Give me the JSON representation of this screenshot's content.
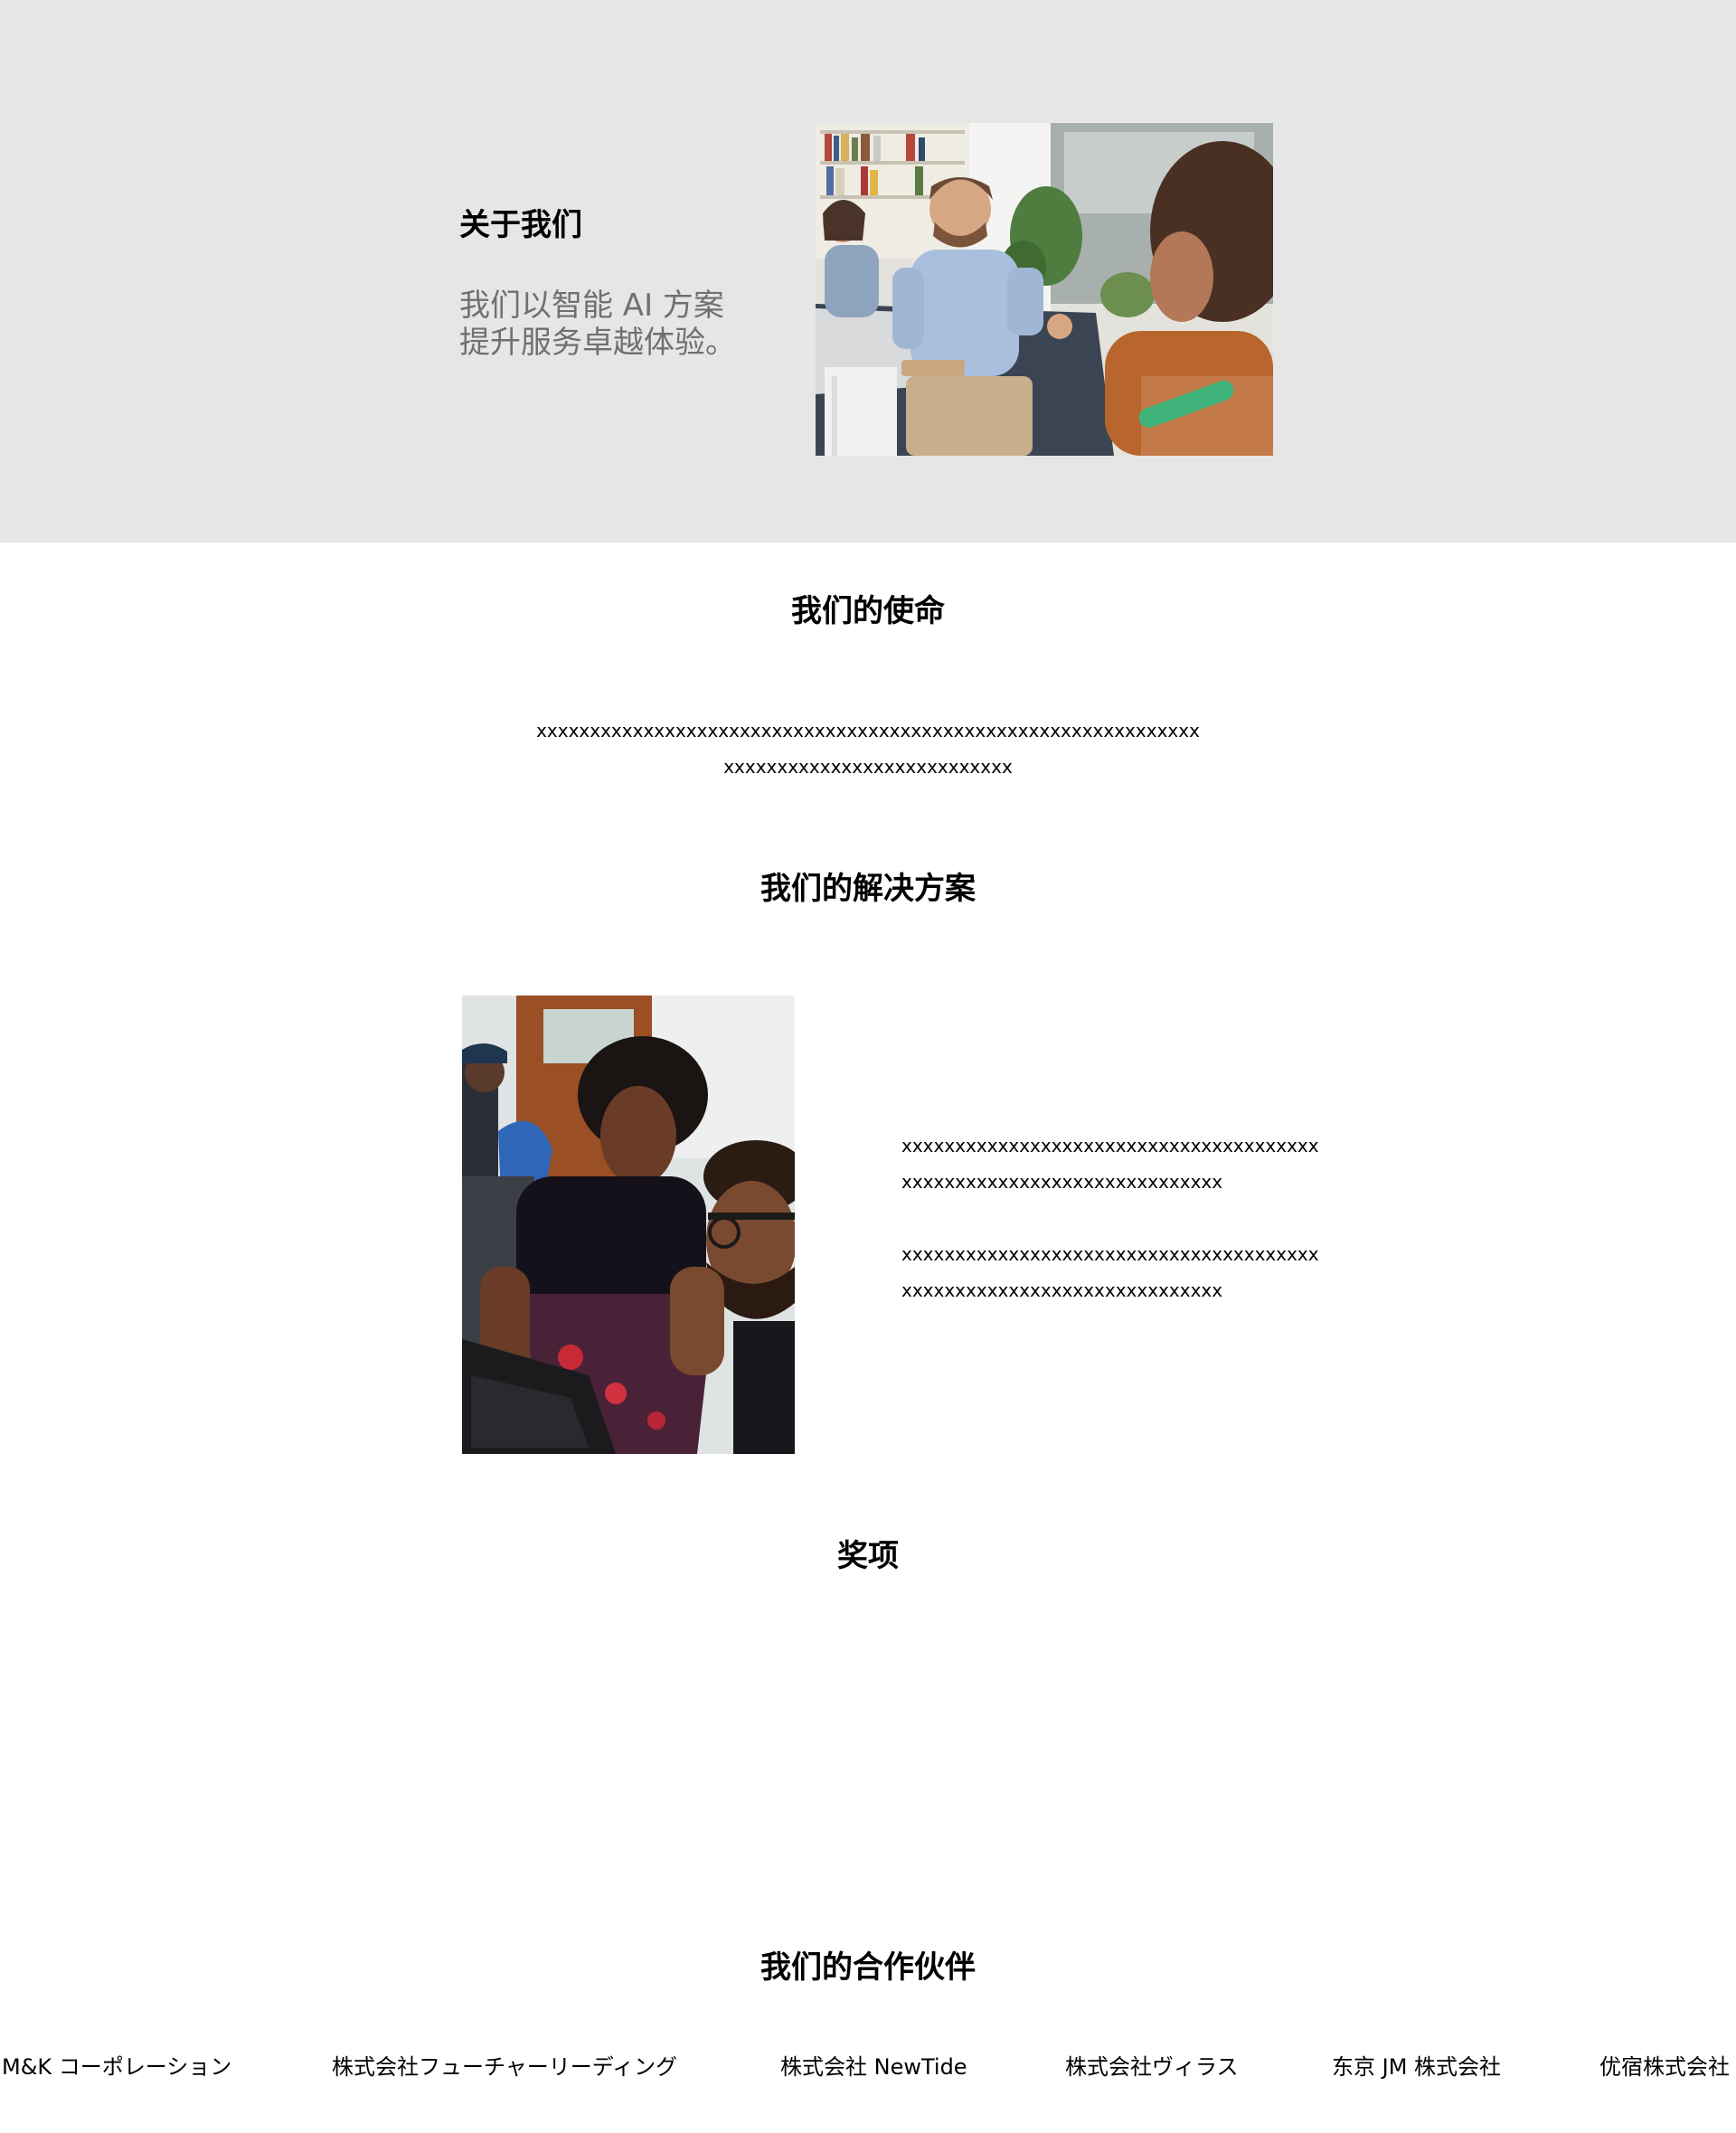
{
  "about": {
    "title": "关于我们",
    "tagline_line1": "我们以智能 AI 方案",
    "tagline_line2": "提升服务卓越体验。"
  },
  "mission": {
    "title": "我们的使命",
    "line1": "xxxxxxxxxxxxxxxxxxxxxxxxxxxxxxxxxxxxxxxxxxxxxxxxxxxxxxxxxxxxxx",
    "line2": "xxxxxxxxxxxxxxxxxxxxxxxxxxx"
  },
  "solutions": {
    "title": "我们的解决方案",
    "paragraph1_line1": "xxxxxxxxxxxxxxxxxxxxxxxxxxxxxxxxxxxxxxx",
    "paragraph1_line2": "xxxxxxxxxxxxxxxxxxxxxxxxxxxxxx",
    "paragraph2_line1": "xxxxxxxxxxxxxxxxxxxxxxxxxxxxxxxxxxxxxxx",
    "paragraph2_line2": "xxxxxxxxxxxxxxxxxxxxxxxxxxxxxx"
  },
  "awards": {
    "title": "奖项"
  },
  "partners": {
    "title": "我们的合作伙伴",
    "items": [
      "M&K コーポレーション",
      "株式会社フューチャーリーディング",
      "株式会社 NewTide",
      "株式会社ヴィラス",
      "东京 JM 株式会社",
      "优宿株式会社"
    ]
  },
  "colors": {
    "hero_background": "#e6e6e6",
    "tagline": "#707070",
    "text": "#000000"
  }
}
